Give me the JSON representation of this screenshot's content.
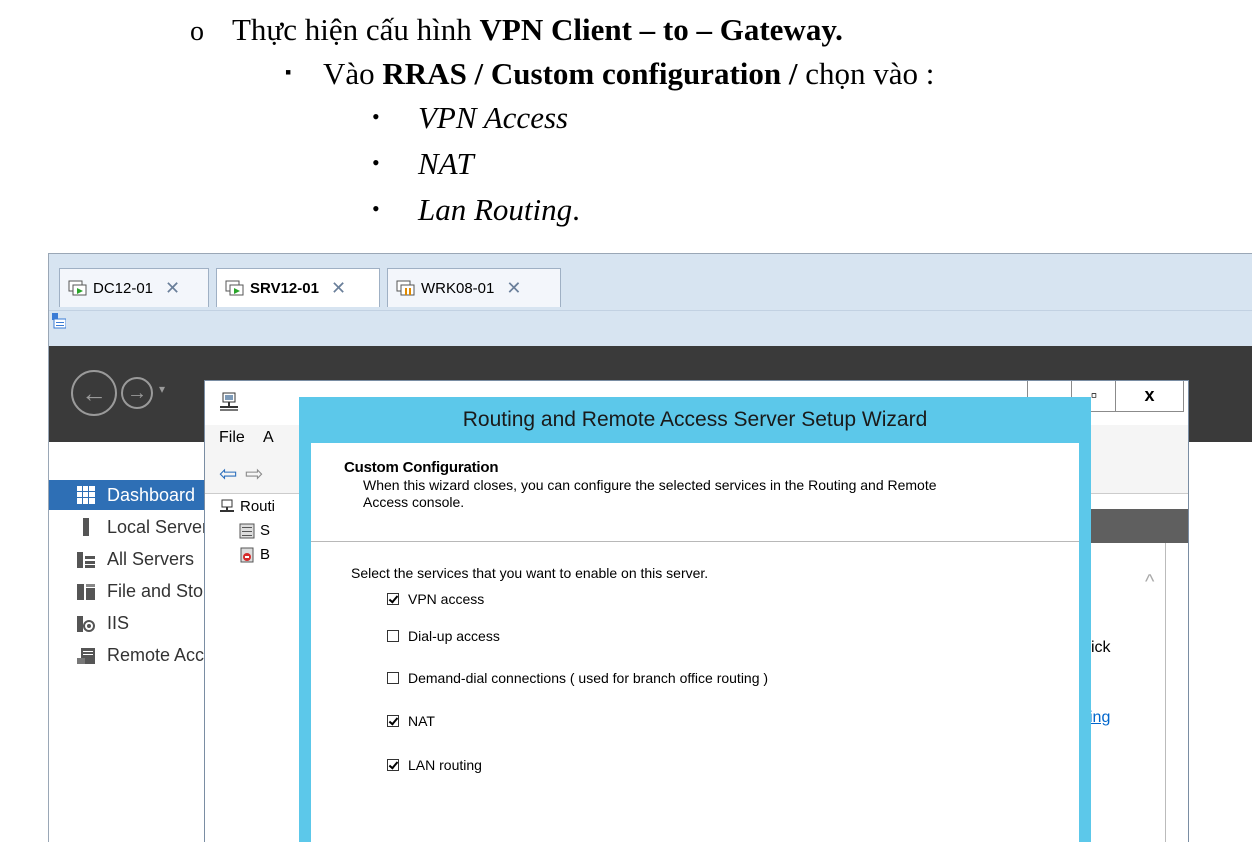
{
  "document": {
    "line1": {
      "bullet": "o",
      "prefix": "Thực hiện cấu hình ",
      "bold": "VPN Client – to – Gateway."
    },
    "line2": {
      "bullet": "▪",
      "prefix": "Vào ",
      "bold": "RRAS / Custom configuration /",
      "suffix": " chọn vào :"
    },
    "items": [
      {
        "bullet": "•",
        "text": "VPN Access"
      },
      {
        "bullet": "•",
        "text": "NAT"
      },
      {
        "bullet": "•",
        "text": "Lan Routing",
        "trail": "."
      }
    ]
  },
  "tabs": [
    {
      "label": "DC12-01",
      "active": false,
      "close": "✕"
    },
    {
      "label": "SRV12-01",
      "active": true,
      "close": "✕"
    },
    {
      "label": "WRK08-01",
      "active": false,
      "close": "✕"
    }
  ],
  "server_manager": {
    "nav": {
      "back": "←",
      "forward": "→",
      "caret": "▾"
    },
    "sidebar": [
      {
        "label": "Dashboard",
        "active": true
      },
      {
        "label": "Local Server",
        "active": false
      },
      {
        "label": "All Servers",
        "active": false
      },
      {
        "label": "File and Storage Services",
        "active": false
      },
      {
        "label": "IIS",
        "active": false
      },
      {
        "label": "Remote Access",
        "active": false
      }
    ],
    "right_panel": {
      "text": "ick",
      "link": "ing",
      "scroll_up": "^"
    }
  },
  "mmc": {
    "buttons": {
      "max": "▫",
      "close": "x"
    },
    "menu": [
      "File",
      "A"
    ],
    "tree": [
      {
        "label": "Routi"
      },
      {
        "label": "S"
      },
      {
        "label": "B"
      }
    ]
  },
  "wizard": {
    "title": "Routing and Remote Access Server Setup Wizard",
    "heading": "Custom Configuration",
    "description": "When this wizard closes, you can configure the selected services in the Routing and Remote Access console.",
    "prompt": "Select the services that you want to enable on this server.",
    "options": [
      {
        "label": "VPN access",
        "checked": true
      },
      {
        "label": "Dial-up access",
        "checked": false
      },
      {
        "label": "Demand-dial connections ( used for branch office routing )",
        "checked": false
      },
      {
        "label": "NAT",
        "checked": true
      },
      {
        "label": "LAN routing",
        "checked": true
      }
    ]
  },
  "colors": {
    "wizard_frame": "#5cc8ea",
    "sidebar_active": "#2e6fb5",
    "tabbar": "#d7e4f1",
    "dark_header": "#3a3a3a"
  }
}
